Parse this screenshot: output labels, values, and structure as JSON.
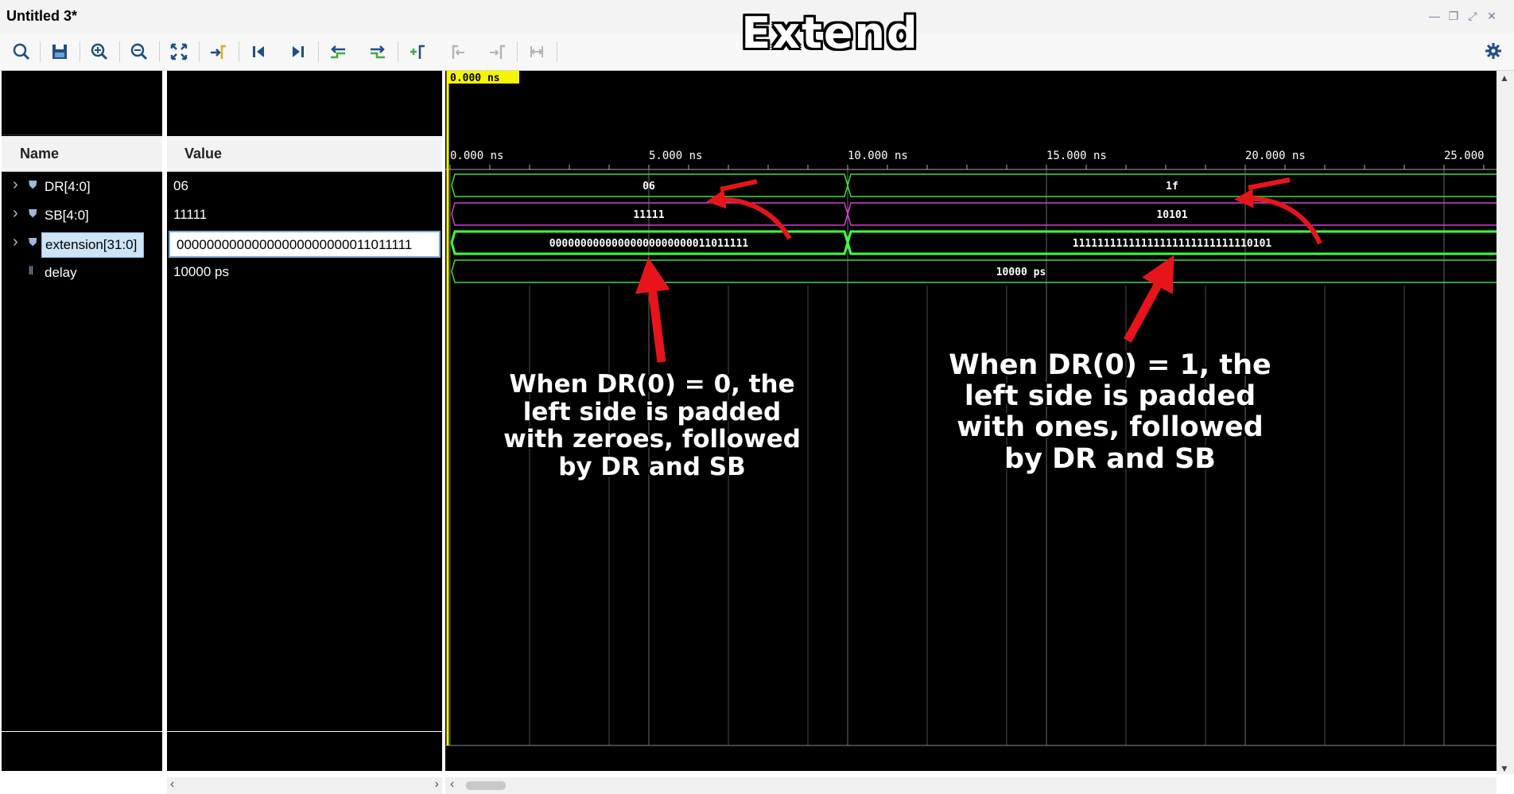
{
  "window": {
    "title": "Untitled 3*"
  },
  "overlay_title": "Extend",
  "columns": {
    "name": "Name",
    "value": "Value"
  },
  "signals": [
    {
      "name": "DR[4:0]",
      "value": "06",
      "expandable": true
    },
    {
      "name": "SB[4:0]",
      "value": "11111",
      "expandable": true
    },
    {
      "name": "extension[31:0]",
      "value": "00000000000000000000000011011111",
      "expandable": true,
      "selected": true
    },
    {
      "name": "delay",
      "value": "10000 ps",
      "expandable": false
    }
  ],
  "waveform": {
    "cursor_label": "0.000 ns",
    "time_ticks": [
      "0.000 ns",
      "5.000 ns",
      "10.000 ns",
      "15.000 ns",
      "20.000 ns",
      "25.000"
    ],
    "rows": [
      {
        "seg1": "06",
        "seg2": "1f",
        "color": "#3fdc3f"
      },
      {
        "seg1": "11111",
        "seg2": "10101",
        "color": "#d23fd2"
      },
      {
        "seg1": "00000000000000000000000011011111",
        "seg2": "11111111111111111111111111110101",
        "color": "#3fff3f"
      },
      {
        "full": "10000 ps",
        "color": "#3fdc3f"
      }
    ]
  },
  "annotations": {
    "left": [
      "When DR(0) = 0, the",
      "left side is padded",
      "with zeroes, followed",
      "by DR and SB"
    ],
    "right": [
      "When DR(0) = 1, the",
      "left side is padded",
      "with ones, followed",
      "by DR and SB"
    ]
  },
  "colors": {
    "arrow": "#e8141c",
    "cursor": "#f5f500",
    "grid": "#6a6a6a"
  },
  "icons": [
    "search-icon",
    "save-icon",
    "zoom-in-icon",
    "zoom-out-icon",
    "zoom-fit-icon",
    "go-to-cursor-icon",
    "go-to-start-icon",
    "go-to-end-icon",
    "previous-transition-icon",
    "next-transition-icon",
    "add-marker-icon",
    "previous-marker-icon",
    "next-marker-icon",
    "swap-cursors-icon",
    "gear-icon"
  ]
}
